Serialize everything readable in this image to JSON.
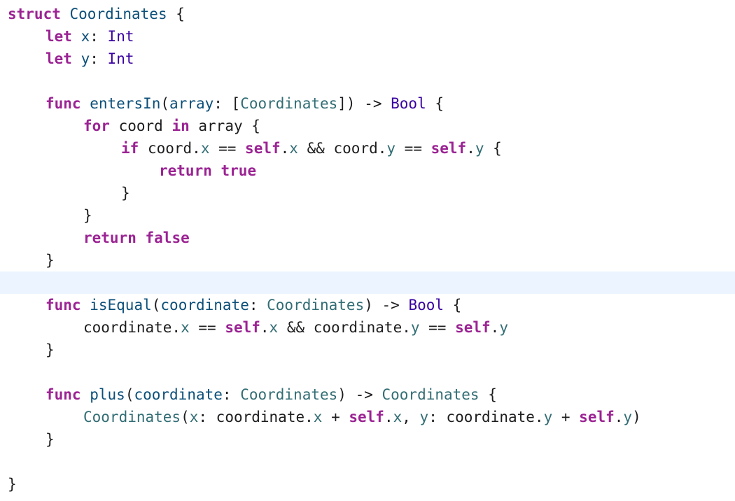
{
  "colors": {
    "keyword": "#9b2393",
    "type": "#3900a0",
    "declaration": "#0b4f79",
    "user_symbol": "#326d74",
    "plain": "#1d1d1f",
    "current_line": "#ecf5ff"
  },
  "editor": {
    "current_line_index": 12,
    "lines": [
      {
        "indent": 0,
        "tokens": [
          [
            "kw",
            "struct"
          ],
          [
            "plain",
            " "
          ],
          [
            "decl",
            "Coordinates"
          ],
          [
            "plain",
            " {"
          ]
        ]
      },
      {
        "indent": 1,
        "tokens": [
          [
            "kw",
            "let"
          ],
          [
            "plain",
            " "
          ],
          [
            "decl",
            "x"
          ],
          [
            "plain",
            ": "
          ],
          [
            "type",
            "Int"
          ]
        ]
      },
      {
        "indent": 1,
        "tokens": [
          [
            "kw",
            "let"
          ],
          [
            "plain",
            " "
          ],
          [
            "decl",
            "y"
          ],
          [
            "plain",
            ": "
          ],
          [
            "type",
            "Int"
          ]
        ]
      },
      {
        "indent": 0,
        "tokens": []
      },
      {
        "indent": 1,
        "tokens": [
          [
            "kw",
            "func"
          ],
          [
            "plain",
            " "
          ],
          [
            "decl",
            "entersIn"
          ],
          [
            "plain",
            "("
          ],
          [
            "decl",
            "array"
          ],
          [
            "plain",
            ": ["
          ],
          [
            "user",
            "Coordinates"
          ],
          [
            "plain",
            "]) -> "
          ],
          [
            "type",
            "Bool"
          ],
          [
            "plain",
            " {"
          ]
        ]
      },
      {
        "indent": 2,
        "tokens": [
          [
            "kw",
            "for"
          ],
          [
            "plain",
            " coord "
          ],
          [
            "kw",
            "in"
          ],
          [
            "plain",
            " array {"
          ]
        ]
      },
      {
        "indent": 3,
        "tokens": [
          [
            "kw",
            "if"
          ],
          [
            "plain",
            " coord."
          ],
          [
            "user",
            "x"
          ],
          [
            "plain",
            " == "
          ],
          [
            "kw",
            "self"
          ],
          [
            "plain",
            "."
          ],
          [
            "user",
            "x"
          ],
          [
            "plain",
            " && coord."
          ],
          [
            "user",
            "y"
          ],
          [
            "plain",
            " == "
          ],
          [
            "kw",
            "self"
          ],
          [
            "plain",
            "."
          ],
          [
            "user",
            "y"
          ],
          [
            "plain",
            " {"
          ]
        ]
      },
      {
        "indent": 4,
        "tokens": [
          [
            "kw",
            "return"
          ],
          [
            "plain",
            " "
          ],
          [
            "kw",
            "true"
          ]
        ]
      },
      {
        "indent": 3,
        "tokens": [
          [
            "plain",
            "}"
          ]
        ]
      },
      {
        "indent": 2,
        "tokens": [
          [
            "plain",
            "}"
          ]
        ]
      },
      {
        "indent": 2,
        "tokens": [
          [
            "kw",
            "return"
          ],
          [
            "plain",
            " "
          ],
          [
            "kw",
            "false"
          ]
        ]
      },
      {
        "indent": 1,
        "tokens": [
          [
            "plain",
            "}"
          ]
        ]
      },
      {
        "indent": 0,
        "tokens": []
      },
      {
        "indent": 1,
        "tokens": [
          [
            "kw",
            "func"
          ],
          [
            "plain",
            " "
          ],
          [
            "decl",
            "isEqual"
          ],
          [
            "plain",
            "("
          ],
          [
            "decl",
            "coordinate"
          ],
          [
            "plain",
            ": "
          ],
          [
            "user",
            "Coordinates"
          ],
          [
            "plain",
            ") -> "
          ],
          [
            "type",
            "Bool"
          ],
          [
            "plain",
            " {"
          ]
        ]
      },
      {
        "indent": 2,
        "tokens": [
          [
            "plain",
            "coordinate."
          ],
          [
            "user",
            "x"
          ],
          [
            "plain",
            " == "
          ],
          [
            "kw",
            "self"
          ],
          [
            "plain",
            "."
          ],
          [
            "user",
            "x"
          ],
          [
            "plain",
            " && coordinate."
          ],
          [
            "user",
            "y"
          ],
          [
            "plain",
            " == "
          ],
          [
            "kw",
            "self"
          ],
          [
            "plain",
            "."
          ],
          [
            "user",
            "y"
          ]
        ]
      },
      {
        "indent": 1,
        "tokens": [
          [
            "plain",
            "}"
          ]
        ]
      },
      {
        "indent": 0,
        "tokens": []
      },
      {
        "indent": 1,
        "tokens": [
          [
            "kw",
            "func"
          ],
          [
            "plain",
            " "
          ],
          [
            "decl",
            "plus"
          ],
          [
            "plain",
            "("
          ],
          [
            "decl",
            "coordinate"
          ],
          [
            "plain",
            ": "
          ],
          [
            "user",
            "Coordinates"
          ],
          [
            "plain",
            ") -> "
          ],
          [
            "user",
            "Coordinates"
          ],
          [
            "plain",
            " {"
          ]
        ]
      },
      {
        "indent": 2,
        "tokens": [
          [
            "user",
            "Coordinates"
          ],
          [
            "plain",
            "("
          ],
          [
            "user",
            "x"
          ],
          [
            "plain",
            ": coordinate."
          ],
          [
            "user",
            "x"
          ],
          [
            "plain",
            " + "
          ],
          [
            "kw",
            "self"
          ],
          [
            "plain",
            "."
          ],
          [
            "user",
            "x"
          ],
          [
            "plain",
            ", "
          ],
          [
            "user",
            "y"
          ],
          [
            "plain",
            ": coordinate."
          ],
          [
            "user",
            "y"
          ],
          [
            "plain",
            " + "
          ],
          [
            "kw",
            "self"
          ],
          [
            "plain",
            "."
          ],
          [
            "user",
            "y"
          ],
          [
            "plain",
            ")"
          ]
        ]
      },
      {
        "indent": 1,
        "tokens": [
          [
            "plain",
            "}"
          ]
        ]
      },
      {
        "indent": 0,
        "tokens": []
      },
      {
        "indent": 0,
        "tokens": [
          [
            "plain",
            "}"
          ]
        ]
      }
    ]
  }
}
